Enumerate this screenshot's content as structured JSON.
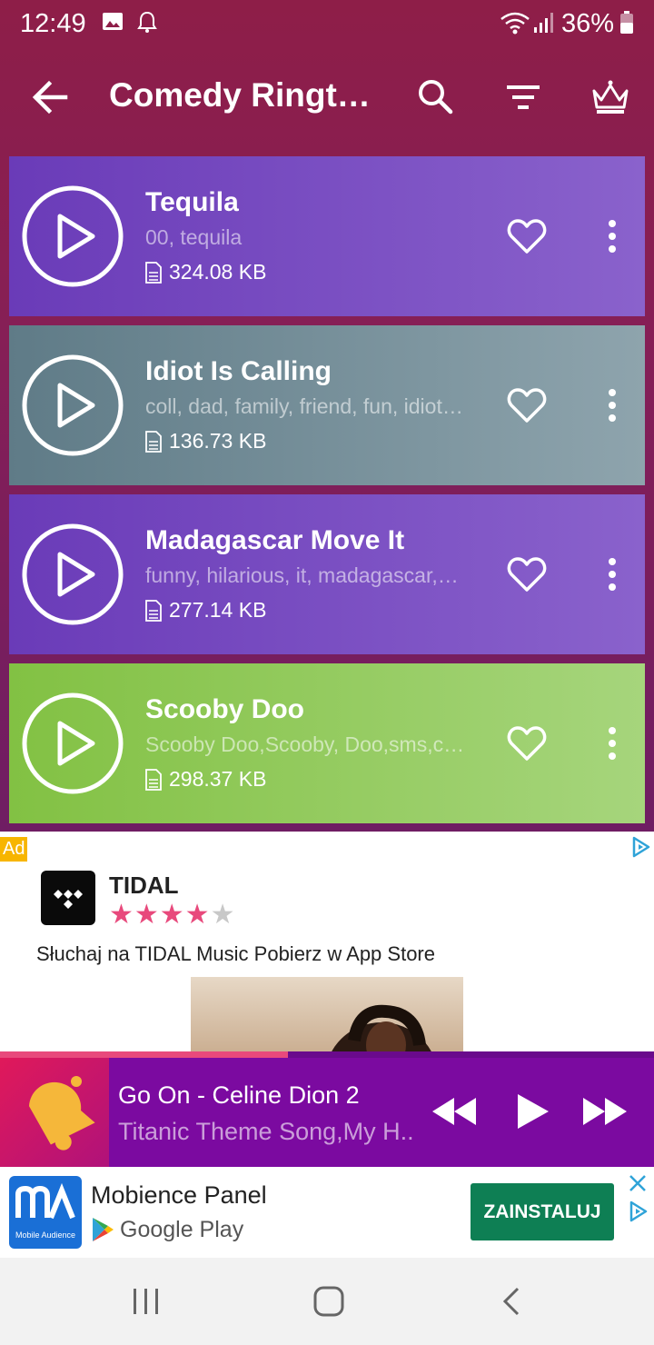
{
  "status_bar": {
    "time": "12:49",
    "battery": "36%"
  },
  "toolbar": {
    "title": "Comedy Ringto…"
  },
  "ringtones": [
    {
      "title": "Tequila",
      "tags": "00, tequila",
      "size": "324.08 KB"
    },
    {
      "title": "Idiot Is Calling",
      "tags": "coll, dad, family, friend, fun, idiot…",
      "size": "136.73 KB"
    },
    {
      "title": "Madagascar Move It",
      "tags": "funny, hilarious, it, madagascar,…",
      "size": "277.14 KB"
    },
    {
      "title": "Scooby Doo",
      "tags": "Scooby Doo,Scooby, Doo,sms,c…",
      "size": "298.37 KB"
    }
  ],
  "ad": {
    "tag": "Ad",
    "app_name": "TIDAL",
    "rating_stars": 4,
    "description": "Słuchaj na TIDAL Music Pobierz w App Store"
  },
  "player": {
    "song": "Go On - Celine Dion 2",
    "subtitle": "Titanic Theme Song,My H..",
    "progress": 0.44
  },
  "bottom_ad": {
    "app_name": "Mobience Panel",
    "store": "Google Play",
    "install_label": "ZAINSTALUJ",
    "logo_text": "Mobile Audience"
  },
  "colors": {
    "card_purple": "#7e57c2",
    "card_gray": "#78909c",
    "card_green": "#8bc34a",
    "install_green": "#0e7f54",
    "player_purple": "#7b0aa0",
    "star_pink": "#e8497c"
  }
}
